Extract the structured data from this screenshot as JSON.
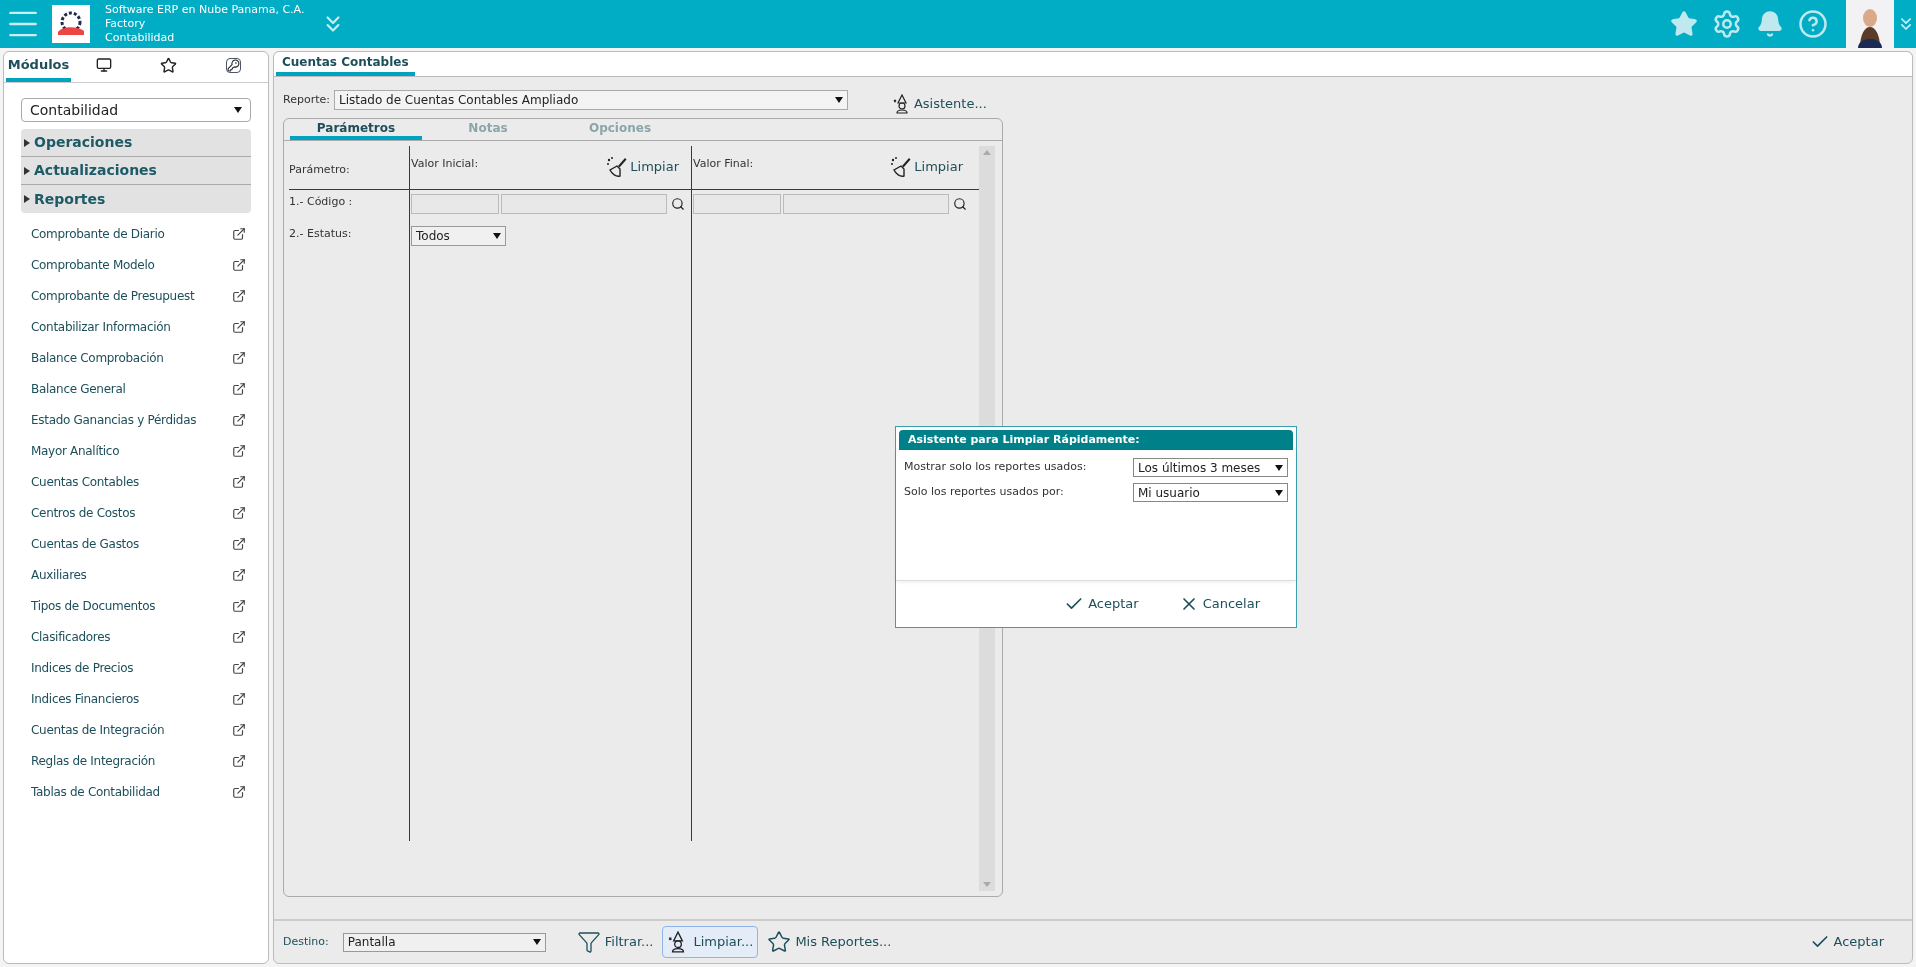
{
  "header": {
    "company_lines": [
      "Software ERP en Nube Panama, C.A.",
      "Factory",
      "Contabilidad"
    ]
  },
  "sidebar": {
    "tabs": [
      {
        "kind": "text",
        "label": "Módulos",
        "selected": true
      },
      {
        "kind": "monitor",
        "selected": false
      },
      {
        "kind": "star",
        "selected": false
      },
      {
        "kind": "key",
        "selected": false
      }
    ],
    "module_select": "Contabilidad",
    "sections": [
      {
        "label": "Operaciones",
        "expanded": false
      },
      {
        "label": "Actualizaciones",
        "expanded": false
      },
      {
        "label": "Reportes",
        "expanded": false
      }
    ],
    "items": [
      "Comprobante de Diario",
      "Comprobante Modelo",
      "Comprobante de Presupuest",
      "Contabilizar Información",
      "Balance Comprobación",
      "Balance General",
      "Estado Ganancias y Pérdidas",
      "Mayor Analítico",
      "Cuentas Contables",
      "Centros de Costos",
      "Cuentas de Gastos",
      "Auxiliares",
      "Tipos de Documentos",
      "Clasificadores",
      "Indices de Precios",
      "Indices Financieros",
      "Cuentas de Integración",
      "Reglas de Integración",
      "Tablas de Contabilidad"
    ]
  },
  "main": {
    "tabs": [
      {
        "label": "Cuentas Contables",
        "selected": true
      }
    ],
    "report_label": "Reporte:",
    "report_value": "Listado de Cuentas Contables Ampliado",
    "wizard_button": "Asistente...",
    "inner_tabs": [
      {
        "label": "Parámetros",
        "selected": true
      },
      {
        "label": "Notas",
        "selected": false
      },
      {
        "label": "Opciones",
        "selected": false
      }
    ],
    "param_header": {
      "parameter": "Parámetro:",
      "initial": "Valor Inicial:",
      "initial_clear": "Limpiar",
      "final": "Valor Final:",
      "final_clear": "Limpiar"
    },
    "param_rows": [
      {
        "kind": "lookup",
        "label": "1.- Código :"
      },
      {
        "kind": "select",
        "label": "2.- Estatus:",
        "value": "Todos"
      }
    ]
  },
  "dialog": {
    "title": "Asistente para Limpiar Rápidamente:",
    "fields": [
      {
        "label": "Mostrar solo los reportes usados:",
        "value": "Los últimos 3 meses"
      },
      {
        "label": "Solo los reportes usados por:",
        "value": "Mi usuario"
      }
    ],
    "buttons": [
      {
        "kind": "accept",
        "label": "Aceptar"
      },
      {
        "kind": "cancel",
        "label": "Cancelar"
      }
    ]
  },
  "footer": {
    "destino_label": "Destino:",
    "destino_value": "Pantalla",
    "buttons": [
      {
        "kind": "filter",
        "label": "Filtrar...",
        "selected": false
      },
      {
        "kind": "wizard",
        "label": "Limpiar...",
        "selected": true
      },
      {
        "kind": "star",
        "label": "Mis Reportes...",
        "selected": false
      }
    ],
    "accept": "Aceptar"
  }
}
